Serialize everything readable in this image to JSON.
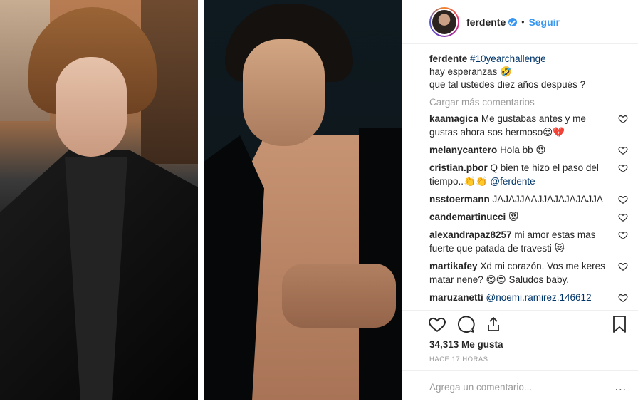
{
  "post": {
    "images": [
      "photo-2009",
      "photo-2019"
    ]
  },
  "header": {
    "username": "ferdente",
    "separator": "•",
    "follow_label": "Seguir"
  },
  "caption": {
    "username": "ferdente",
    "hashtag": "#10yearchallenge",
    "line1": "hay esperanzas 🤣",
    "line2": "que tal ustedes diez años después ?"
  },
  "load_more": "Cargar más comentarios",
  "comments": [
    {
      "user": "kaamagica",
      "text": "Me gustabas antes y me gustas ahora sos hermoso😍💔"
    },
    {
      "user": "melanycantero",
      "text": "Hola bb 😍"
    },
    {
      "user": "cristian.pbor",
      "text": "Q bien te hizo el paso del tiempo..👏👏",
      "mention": "@ferdente"
    },
    {
      "user": "nsstoermann",
      "text": "JAJAJJAAJJAJAJAJAJJA"
    },
    {
      "user": "candemartinucci",
      "text": "😻"
    },
    {
      "user": "alexandrapaz8257",
      "text": "mi amor estas mas fuerte que patada de travesti 😻"
    },
    {
      "user": "martikafey",
      "text": "Xd mi corazón. Vos me keres matar nene? 😋😍 Saludos baby."
    },
    {
      "user": "maruzanetti",
      "text": "",
      "mention": "@noemi.ramirez.146612"
    }
  ],
  "likes": "34,313 Me gusta",
  "time": "HACE 17 HORAS",
  "add_comment": {
    "placeholder": "Agrega un comentario..."
  },
  "more_options": "...",
  "icons": {
    "like": "heart-icon",
    "comment": "comment-icon",
    "share": "share-icon",
    "save": "bookmark-icon",
    "verified": "verified-badge-icon"
  },
  "colors": {
    "link": "#3897f0",
    "hashtag": "#003569",
    "muted": "#999999",
    "border": "#efefef"
  }
}
